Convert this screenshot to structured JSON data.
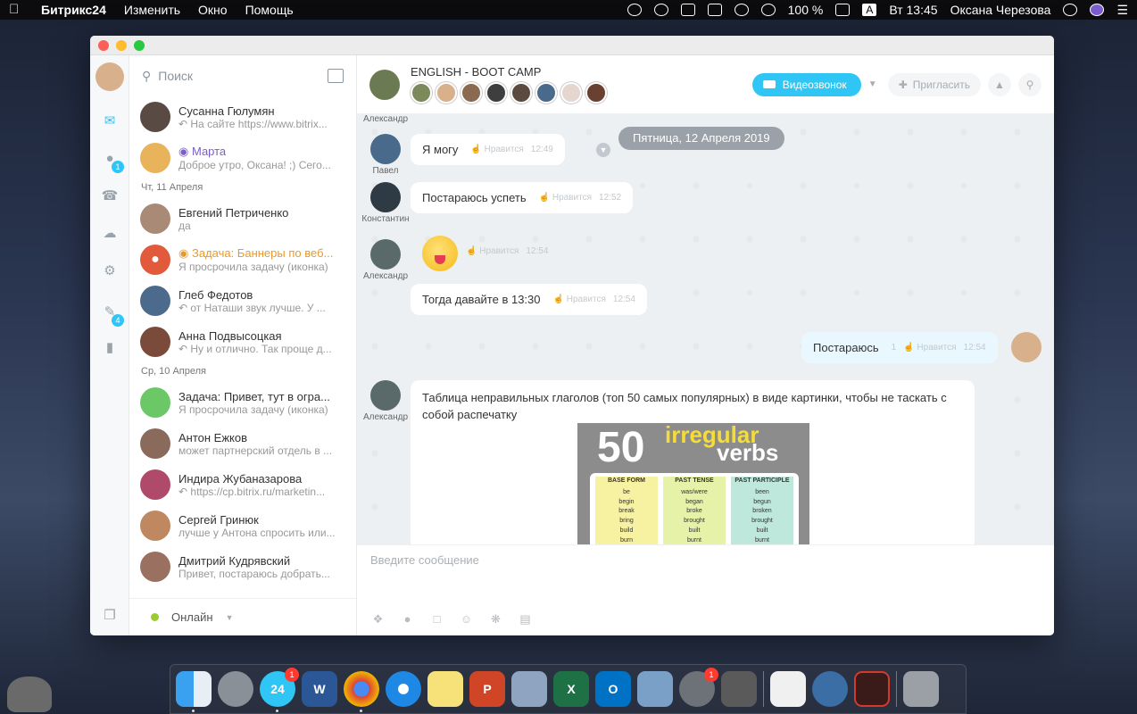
{
  "menubar": {
    "app_name": "Битрикс24",
    "menus": [
      "Изменить",
      "Окно",
      "Помощь"
    ],
    "battery": "100 %",
    "input_source": "A",
    "clock": "Вт 13:45",
    "user": "Оксана Черезова"
  },
  "search": {
    "placeholder": "Поиск"
  },
  "iconbar": {
    "badge_notifications": "1",
    "badge_tasks": "4"
  },
  "chats": {
    "items": [
      {
        "name": "Сусанна Гюлумян",
        "preview": "На сайте https://www.bitrix..."
      },
      {
        "name": "Марта",
        "preview": "Доброе утро, Оксана! ;) Сего..."
      }
    ],
    "date1": "Чт, 11 Апреля",
    "items2": [
      {
        "name": "Евгений Петриченко",
        "preview": "да"
      },
      {
        "name": "Задача: Баннеры по веб...",
        "preview": "Я просрочила задачу (иконка)"
      },
      {
        "name": "Глеб Федотов",
        "preview": "от Наташи звук лучше. У ..."
      },
      {
        "name": "Анна Подвысоцкая",
        "preview": "Ну и отлично. Так проще д..."
      }
    ],
    "date2": "Ср, 10 Апреля",
    "items3": [
      {
        "name": "Задача: Привет, тут в огра...",
        "preview": "Я просрочила задачу (иконка)"
      },
      {
        "name": "Антон Ежков",
        "preview": "может партнерский отдель в ..."
      },
      {
        "name": "Индира Жубаназарова",
        "preview": "https://cp.bitrix.ru/marketin..."
      },
      {
        "name": "Сергей Гринюк",
        "preview": "лучше у Антона спросить или..."
      },
      {
        "name": "Дмитрий Кудрявский",
        "preview": "Привет, постараюсь добрать..."
      }
    ]
  },
  "status": {
    "label": "Онлайн"
  },
  "chat_header": {
    "title": "ENGLISH - BOOT CAMP",
    "video_button": "Видеозвонок",
    "invite_button": "Пригласить"
  },
  "messages": {
    "top_sender": "Александр",
    "date_pill": "Пятница, 12 Апреля 2019",
    "like_label": "Нравится",
    "m1": {
      "sender": "Павел",
      "text": "Я могу",
      "time": "12:49"
    },
    "m2": {
      "sender": "Константин",
      "text": "Постараюсь успеть",
      "time": "12:52"
    },
    "m3": {
      "sender": "Александр",
      "time": "12:54"
    },
    "m4": {
      "text": "Тогда давайте в 13:30",
      "time": "12:54"
    },
    "m5": {
      "text": "Постараюсь",
      "count": "1",
      "time": "12:54"
    },
    "m6": {
      "sender": "Александр",
      "text": "Таблица неправильных глаголов (топ 50 самых популярных) в виде картинки, чтобы не таскать с собой распечатку"
    }
  },
  "poster": {
    "number": "50",
    "word1": "irregular",
    "word2": "verbs",
    "col1": {
      "header": "BASE FORM",
      "rows": [
        "be",
        "begin",
        "break",
        "bring",
        "build",
        "burn"
      ]
    },
    "col2": {
      "header": "PAST TENSE",
      "rows": [
        "was/were",
        "began",
        "broke",
        "brought",
        "built",
        "burnt"
      ]
    },
    "col3": {
      "header": "PAST PARTICIPLE",
      "rows": [
        "been",
        "begun",
        "broken",
        "brought",
        "built",
        "burnt"
      ]
    }
  },
  "composer": {
    "placeholder": "Введите сообщение"
  },
  "dock": {
    "badge_calendar": "1",
    "badge_prefs": "1",
    "calendar_day": "24"
  }
}
